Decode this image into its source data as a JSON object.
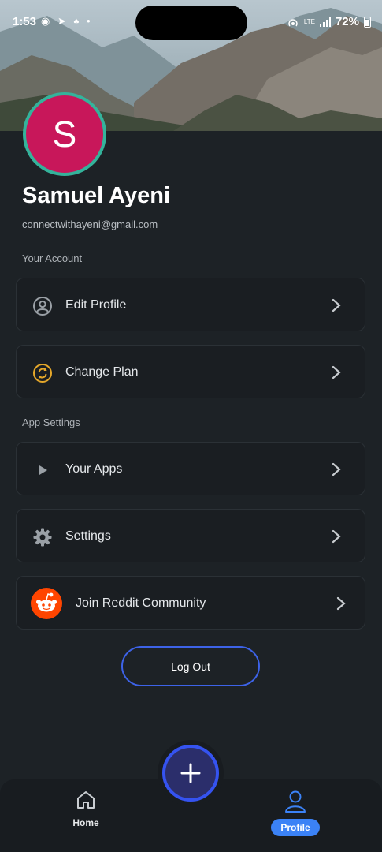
{
  "status_bar": {
    "time": "1:53",
    "left_icons": "◉ ➤ ♠ •",
    "network": "LTE",
    "battery": "72%"
  },
  "profile": {
    "initial": "S",
    "name": "Samuel Ayeni",
    "email": "connectwithayeni@gmail.com",
    "avatar_color": "#c8175a",
    "avatar_ring_color": "#34b39b"
  },
  "sections": {
    "account_label": "Your Account",
    "app_settings_label": "App Settings"
  },
  "menu": {
    "edit_profile": "Edit Profile",
    "change_plan": "Change Plan",
    "your_apps": "Your Apps",
    "settings": "Settings",
    "reddit": "Join Reddit Community"
  },
  "logout_label": "Log Out",
  "bottom_nav": {
    "home_label": "Home",
    "profile_label": "Profile",
    "accent_color": "#3b82f6"
  }
}
